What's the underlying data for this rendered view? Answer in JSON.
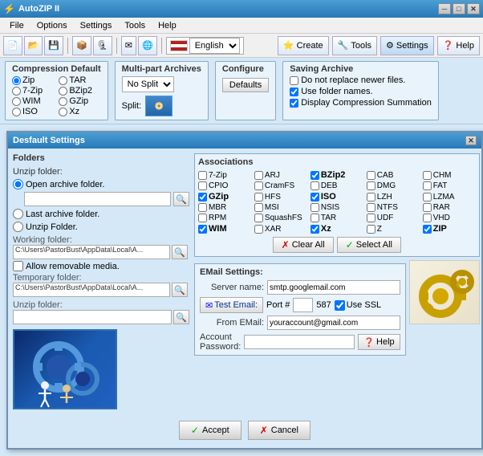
{
  "app": {
    "title": "AutoZIP II",
    "title_icon": "⚡"
  },
  "title_bar": {
    "title": "AutoZIP II",
    "minimize": "─",
    "maximize": "□",
    "close": "✕"
  },
  "menu": {
    "items": [
      "File",
      "Options",
      "Settings",
      "Tools",
      "Help"
    ]
  },
  "toolbar": {
    "language": "English",
    "buttons_right": [
      "Create",
      "Tools",
      "Settings",
      "Help"
    ]
  },
  "options": {
    "compression_default": {
      "label": "Compression Default",
      "options": [
        "Zip",
        "TAR",
        "7-Zip",
        "BZip2",
        "WIM",
        "GZip",
        "ISO",
        "Xz"
      ]
    },
    "multipart": {
      "label": "Multi-part Archives",
      "split_label": "Split:",
      "split_value": "No Split"
    },
    "configure": {
      "label": "Configure",
      "defaults_btn": "Defaults"
    },
    "saving": {
      "label": "Saving Archive",
      "options": [
        "Do not replace newer files.",
        "Use folder names.",
        "Display Compression Summation"
      ]
    }
  },
  "dialog": {
    "title": "Desfault Settings",
    "close": "✕",
    "folders": {
      "title": "Folders",
      "unzip_label": "Unzip folder:",
      "open_archive": "Open archive folder.",
      "last_archive": "Last archive folder.",
      "unzip_folder": "Unzip Folder.",
      "working_label": "Working folder:",
      "working_path": "C:\\Users\\PastorBust\\AppData\\Local\\A...",
      "allow_removable": "Allow removable media.",
      "temp_label": "Temporary folder:",
      "temp_path": "C:\\Users\\PastorBust\\AppData\\Local\\A...",
      "unzip_subfolder": "Unzip folder:"
    },
    "associations": {
      "title": "Associations",
      "items": [
        {
          "label": "7-Zip",
          "checked": false
        },
        {
          "label": "ARJ",
          "checked": false
        },
        {
          "label": "BZip2",
          "checked": true
        },
        {
          "label": "CAB",
          "checked": false
        },
        {
          "label": "CHM",
          "checked": false
        },
        {
          "label": "CPIO",
          "checked": false
        },
        {
          "label": "CramFS",
          "checked": false
        },
        {
          "label": "DEB",
          "checked": false
        },
        {
          "label": "DMG",
          "checked": false
        },
        {
          "label": "FAT",
          "checked": false
        },
        {
          "label": "GZip",
          "checked": true
        },
        {
          "label": "HFS",
          "checked": false
        },
        {
          "label": "ISO",
          "checked": true
        },
        {
          "label": "LZH",
          "checked": false
        },
        {
          "label": "LZMA",
          "checked": false
        },
        {
          "label": "MBR",
          "checked": false
        },
        {
          "label": "MSI",
          "checked": false
        },
        {
          "label": "NSIS",
          "checked": false
        },
        {
          "label": "NTFS",
          "checked": false
        },
        {
          "label": "RAR",
          "checked": false
        },
        {
          "label": "RPM",
          "checked": false
        },
        {
          "label": "SquashFS",
          "checked": false
        },
        {
          "label": "TAR",
          "checked": false
        },
        {
          "label": "UDF",
          "checked": false
        },
        {
          "label": "VHD",
          "checked": false
        },
        {
          "label": "WIM",
          "checked": true
        },
        {
          "label": "XAR",
          "checked": false
        },
        {
          "label": "Xz",
          "checked": true
        },
        {
          "label": "Z",
          "checked": false
        },
        {
          "label": "ZIP",
          "checked": true
        }
      ],
      "clear_all": "Clear All",
      "select_all": "Select All"
    },
    "email": {
      "title": "EMail Settings:",
      "server_label": "Server name:",
      "server_value": "smtp.googlemail.com",
      "test_btn": "Test Email:",
      "port_label": "Port #",
      "port_value": "587",
      "use_ssl": "Use SSL",
      "from_label": "From EMail:",
      "from_value": "youraccount@gmail.com",
      "account_label": "Account Password:",
      "help_btn": "Help"
    },
    "bottom": {
      "accept_btn": "Accept",
      "cancel_btn": "Cancel"
    }
  }
}
